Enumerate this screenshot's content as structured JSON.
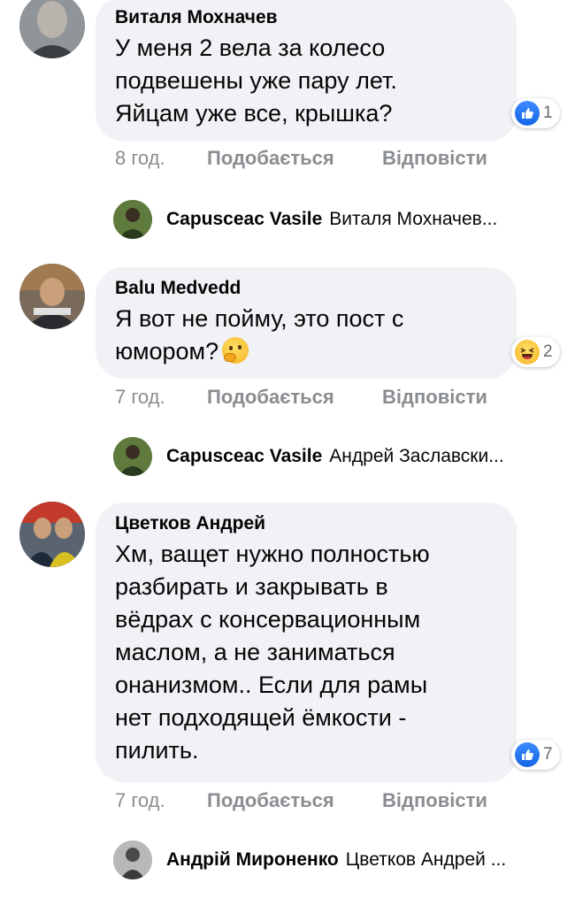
{
  "comments": [
    {
      "author": "Виталя Мохначев",
      "text": "У меня 2 вела за колесо\nподвешены  уже пару лет.\nЯйцам уже все, крышка?",
      "reaction_icon": "like-icon",
      "reaction_count": "1",
      "time": "8 год.",
      "like_label": "Подобається",
      "reply_label": "Відповісти",
      "reply": {
        "author": "Capusceac Vasile",
        "preview": "Виталя Мохначев..."
      }
    },
    {
      "author": "Balu Medvedd",
      "text": "Я вот не пойму, это пост с\nюмором?",
      "text_emoji": "thinking-face-emoji",
      "reaction_icon": "haha-icon",
      "reaction_count": "2",
      "time": "7 год.",
      "like_label": "Подобається",
      "reply_label": "Відповісти",
      "reply": {
        "author": "Capusceac Vasile",
        "preview": "Андрей Заславски..."
      }
    },
    {
      "author": "Цветков Андрей",
      "text": "Хм, ващет нужно полностью\nразбирать и закрывать в\nвёдрах с консервационным\nмаслом, а не заниматься\nонанизмом.. Если для рамы\nнет подходящей ёмкости -\nпилить.",
      "reaction_icon": "like-icon",
      "reaction_count": "7",
      "time": "7 год.",
      "like_label": "Подобається",
      "reply_label": "Відповісти",
      "reply": {
        "author": "Андрій Мироненко",
        "preview": "Цветков Андрей ..."
      }
    }
  ],
  "colors": {
    "bubble": "#f0f2f5",
    "meta_text": "#8a8d91",
    "like_blue": "#1877f2"
  }
}
